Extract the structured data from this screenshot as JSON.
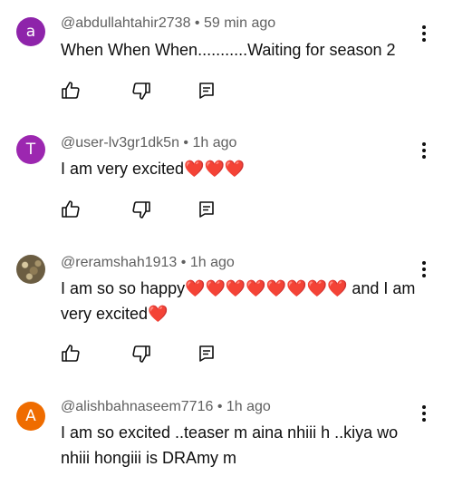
{
  "comments": [
    {
      "avatar_letter": "a",
      "avatar_color": "#8e24aa",
      "handle": "@abdullahtahir2738",
      "time": "59 min ago",
      "text": "When When When...........Waiting for season 2"
    },
    {
      "avatar_letter": "T",
      "avatar_color": "#9c27b0",
      "handle": "@user-lv3gr1dk5n",
      "time": "1h ago",
      "text": "I am very excited❤️❤️❤️"
    },
    {
      "avatar_letter": "",
      "avatar_color": "#6b5d42",
      "handle": "@reramshah1913",
      "time": "1h ago",
      "text": "I am so so happy❤️❤️❤️❤️❤️❤️❤️❤️ and I am very excited❤️"
    },
    {
      "avatar_letter": "A",
      "avatar_color": "#ef6c00",
      "handle": "@alishbahnaseem7716",
      "time": "1h ago",
      "text": "I am so excited ..teaser m aina  nhiii h ..kiya wo nhiii hongiii is DRAmy m"
    }
  ],
  "meta_separator": "•",
  "icons": {
    "like": "thumbs-up-icon",
    "dislike": "thumbs-down-icon",
    "reply": "reply-icon",
    "more": "more-vertical-icon"
  }
}
